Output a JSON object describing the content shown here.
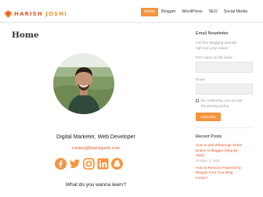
{
  "site": {
    "logo_first": "HARISH",
    "logo_last": "JOSHI",
    "colors": {
      "accent": "#f6943c",
      "brand": "#e8582a"
    }
  },
  "nav": {
    "items": [
      {
        "label": "Home",
        "active": true
      },
      {
        "label": "Blogger",
        "active": false
      },
      {
        "label": "WordPress",
        "active": false
      },
      {
        "label": "SEO",
        "active": false
      },
      {
        "label": "Social Media",
        "active": false
      }
    ]
  },
  "main": {
    "title": "Home",
    "tagline": "Digital Marketer, Web Developer",
    "email": "contact@harishjoshi.com",
    "socials": [
      {
        "name": "facebook-icon",
        "color": "#f6943c"
      },
      {
        "name": "twitter-icon",
        "color": "#f6943c"
      },
      {
        "name": "instagram-icon",
        "color": "#f6943c"
      },
      {
        "name": "linkedin-icon",
        "color": "#f6943c"
      },
      {
        "name": "snapchat-icon",
        "color": "#f6943c"
      }
    ],
    "question": "What do you wanna learn?"
  },
  "sidebar": {
    "newsletter_heading": "Email Newsletter",
    "newsletter_text_1": "Get free blogging tutorials",
    "newsletter_text_2": "right into your inbox!",
    "name_label": "First name or full name",
    "email_label": "Email",
    "consent_line_1": "By continuing, you accept",
    "consent_line_2": "the privacy policy",
    "subscribe_label": "Subscribe",
    "recent_heading": "Recent Posts",
    "posts": [
      {
        "line1": "How to add WhatsApp Share",
        "line2": "Button in Blogger [Step-by-",
        "line3": "Step]",
        "date": "October 3, 2020"
      },
      {
        "line1": "How to Remove Powered by",
        "line2": "Blogger from Your Blog",
        "line3": "Footer?"
      }
    ]
  }
}
